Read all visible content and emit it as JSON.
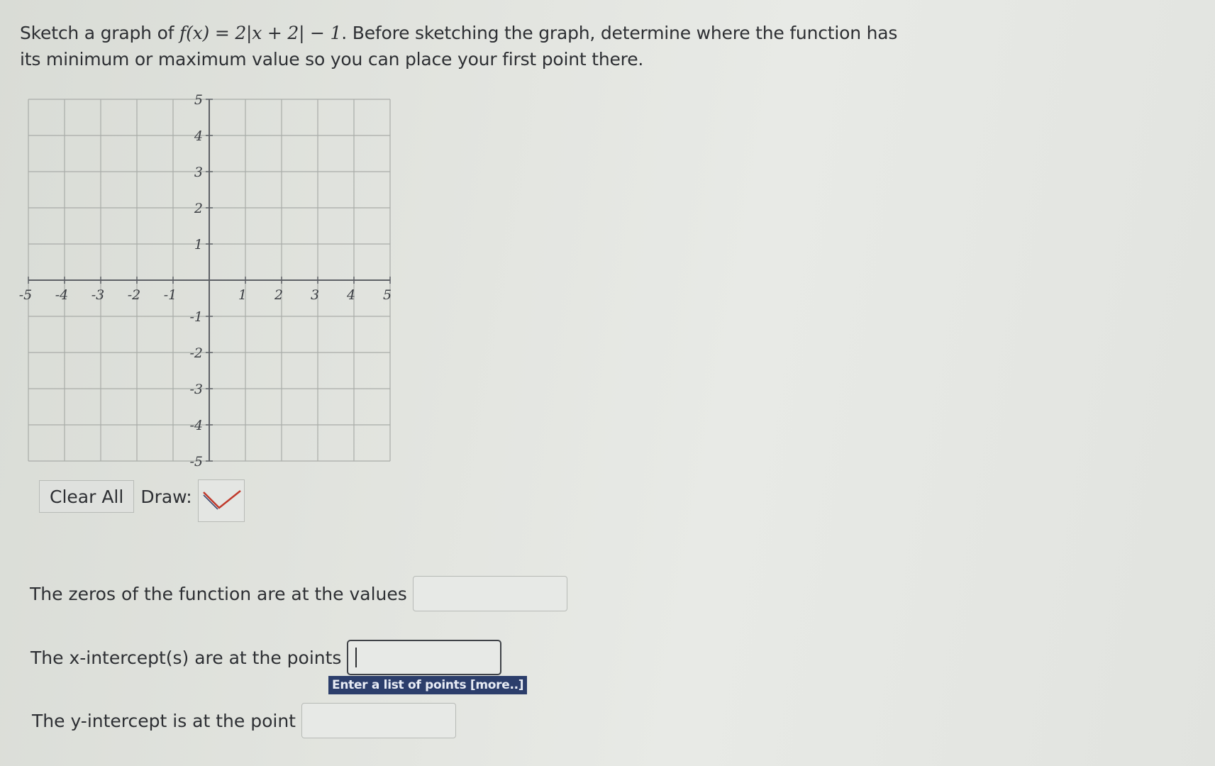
{
  "question": {
    "prefix": "Sketch a graph of ",
    "formula": "f(x) = 2|x + 2| − 1",
    "suffix": ". Before sketching the graph, determine where the function has its minimum or maximum value so you can place your first point there."
  },
  "graph": {
    "x_range": [
      -5,
      5
    ],
    "y_range": [
      -5,
      5
    ],
    "x_tick_labels": [
      "-5",
      "-4",
      "-3",
      "-2",
      "-1",
      "1",
      "2",
      "3",
      "4",
      "5"
    ],
    "y_tick_labels": [
      "5",
      "4",
      "3",
      "2",
      "1",
      "-1",
      "-2",
      "-3",
      "-4",
      "-5"
    ],
    "grid_color": "#a9aca8",
    "axis_color": "#5e6166"
  },
  "toolbar": {
    "clear_label": "Clear All",
    "draw_label": "Draw:",
    "draw_tool_icon": "absolute-value-v-icon",
    "draw_tool_color": "#c0392b"
  },
  "answers": {
    "zeros_label": "The zeros of the function are at the values",
    "zeros_value": "",
    "x_intercepts_label": "The x-intercept(s) are at the points",
    "x_intercepts_value": "",
    "x_intercepts_hint": "Enter a list of points [more..]",
    "y_intercept_label": "The y-intercept is at the point",
    "y_intercept_value": ""
  }
}
